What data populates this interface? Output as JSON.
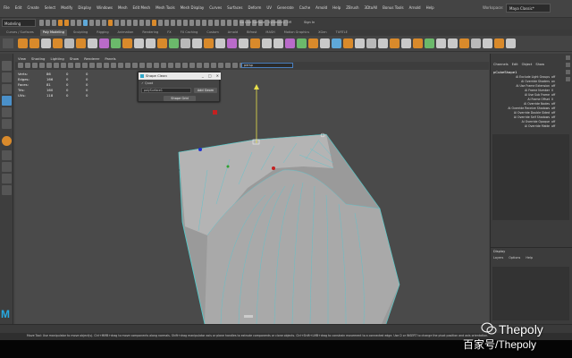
{
  "menubar": {
    "items": [
      "File",
      "Edit",
      "Create",
      "Select",
      "Modify",
      "Display",
      "Windows",
      "Mesh",
      "Edit Mesh",
      "Mesh Tools",
      "Mesh Display",
      "Curves",
      "Surfaces",
      "Deform",
      "UV",
      "Generate",
      "Cache",
      "Arnold",
      "Help",
      "ZBrush",
      "3DtoAll",
      "Bonus Tools",
      "Arnold",
      "Help"
    ],
    "workspace_label": "Workspace:",
    "workspace_value": "Maya Classic*"
  },
  "statusline": {
    "mode": "Modeling",
    "symmetry": "No Live Surface",
    "symmetry_axis": "Symmetry: Off",
    "sign_in": "Sign In"
  },
  "shelf": {
    "tabs": [
      "Curves / Surfaces",
      "Poly Modeling",
      "Sculpting",
      "Rigging",
      "Animation",
      "Rendering",
      "FX",
      "FX Caching",
      "Custom",
      "Arnold",
      "Bifrost",
      "MASH",
      "Motion Graphics",
      "XGen",
      "TURTLE"
    ],
    "active_tab": "Poly Modeling",
    "icon_colors": [
      "#d98a2b",
      "#d98a2b",
      "#c9c9c9",
      "#d98a2b",
      "#b9b9b9",
      "#d98a2b",
      "#c9c9c9",
      "#b96bc9",
      "#6bb96b",
      "#d98a2b",
      "#c9c9c9",
      "#c9c9c9",
      "#d98a2b",
      "#6bb96b",
      "#b9b9b9",
      "#c9c9c9",
      "#d98a2b",
      "#c9c9c9",
      "#b96bc9",
      "#c9c9c9",
      "#d98a2b",
      "#c9c9c9",
      "#c9c9c9",
      "#b96bc9",
      "#6bb96b",
      "#d98a2b",
      "#c9c9c9",
      "#5fa9d9",
      "#d98a2b",
      "#c9c9c9",
      "#b9b9b9",
      "#c9c9c9",
      "#d98a2b",
      "#c9c9c9",
      "#d98a2b",
      "#6bb96b",
      "#c9c9c9",
      "#c9c9c9",
      "#d98a2b",
      "#b9b9b9",
      "#c9c9c9",
      "#d98a2b",
      "#c9c9c9"
    ]
  },
  "viewport": {
    "menu": [
      "View",
      "Shading",
      "Lighting",
      "Show",
      "Renderer",
      "Panels"
    ],
    "camera": "persp",
    "hud": [
      {
        "label": "Verts:",
        "v1": "86",
        "v2": "0",
        "v3": "0"
      },
      {
        "label": "Edges:",
        "v1": "166",
        "v2": "0",
        "v3": "0"
      },
      {
        "label": "Faces:",
        "v1": "81",
        "v2": "0",
        "v3": "0"
      },
      {
        "label": "Tris:",
        "v1": "160",
        "v2": "0",
        "v3": "0"
      },
      {
        "label": "UVs:",
        "v1": "118",
        "v2": "0",
        "v3": "0"
      }
    ]
  },
  "dialog": {
    "title": "Shape Clean",
    "controls": [
      "_",
      "□",
      "✕"
    ],
    "checkbox_label": "Quad",
    "input_value": "polySurface1",
    "add_button": "Add Geom",
    "run_button": "Shape Grid"
  },
  "channelbox": {
    "tabs": [
      "Channels",
      "Edit",
      "Object",
      "Show"
    ],
    "object": "pCubeShape1",
    "attributes": [
      {
        "name": "Ai Exclude Light Groups",
        "value": "off"
      },
      {
        "name": "Ai Override Shaders",
        "value": "on"
      },
      {
        "name": "Ai Use Frame Extension",
        "value": "off"
      },
      {
        "name": "Ai Frame Number",
        "value": "0"
      },
      {
        "name": "Ai Use Sub Frame",
        "value": "off"
      },
      {
        "name": "Ai Frame Offset",
        "value": "0"
      },
      {
        "name": "Ai Override Nodes",
        "value": "off"
      },
      {
        "name": "Ai Override Receive Shadows",
        "value": "off"
      },
      {
        "name": "Ai Override Double Sided",
        "value": "off"
      },
      {
        "name": "Ai Override Self Shadows",
        "value": "off"
      },
      {
        "name": "Ai Override Opaque",
        "value": "off"
      },
      {
        "name": "Ai Override Matte",
        "value": "off"
      }
    ]
  },
  "layers": {
    "tabs": "Display",
    "menu": [
      "Layers",
      "Options",
      "Help"
    ]
  },
  "bottom": {
    "help": "Move Tool: Use manipulator to move object(s). Ctrl+MMB+drag to move components along normals. Shift+drag manipulator axis or plane handles to extrude components or clone objects. Ctrl+Shift+LMB+drag to constrain movement to a connected edge. Use D or INSERT to change the pivot position and axis orientation."
  },
  "watermark": {
    "line1": "Thepoly",
    "line2": "百家号/Thepoly"
  },
  "logo": "M"
}
